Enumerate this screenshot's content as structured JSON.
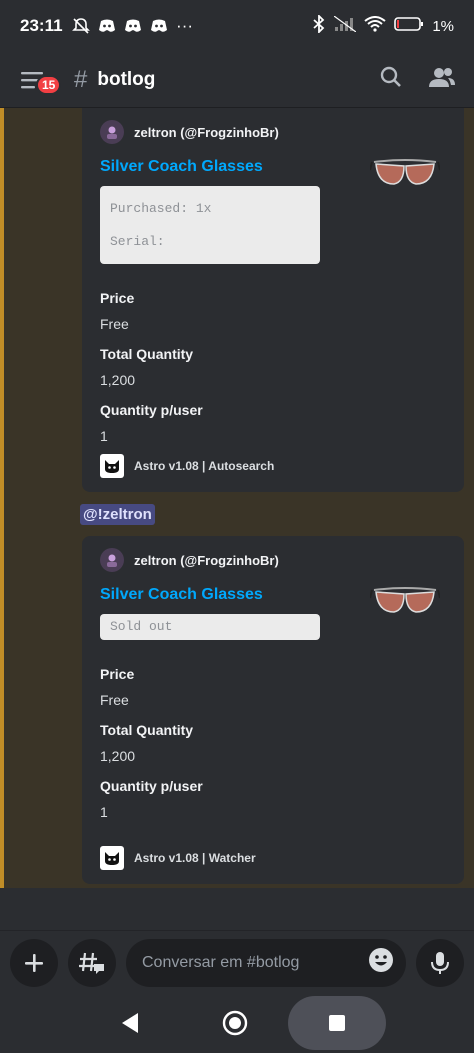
{
  "status_bar": {
    "time": "23:11",
    "icons": [
      "notifications-off-icon",
      "discord-icon",
      "discord-icon",
      "discord-icon",
      "more-icon"
    ],
    "more": "···",
    "battery": "1%",
    "right_icons": [
      "bluetooth-icon",
      "signal-icon",
      "wifi-icon",
      "battery-icon"
    ]
  },
  "header": {
    "badge_count": "15",
    "hash": "#",
    "channel_name": "botlog"
  },
  "messages": [
    {
      "author": "zeltron (@FrogzinhoBr)",
      "title": "Silver Coach Glasses",
      "code_lines": [
        "Purchased: 1x",
        "Serial:"
      ],
      "fields": [
        {
          "name": "Price",
          "value": "Free"
        },
        {
          "name": "Total Quantity",
          "value": "1,200"
        },
        {
          "name": "Quantity p/user",
          "value": "1"
        }
      ],
      "footer": "Astro v1.08 | Autosearch"
    },
    {
      "mention": "@!zeltron",
      "author": "zeltron (@FrogzinhoBr)",
      "title": "Silver Coach Glasses",
      "code_lines": [
        "Sold out"
      ],
      "fields": [
        {
          "name": "Price",
          "value": "Free"
        },
        {
          "name": "Total Quantity",
          "value": "1,200"
        },
        {
          "name": "Quantity p/user",
          "value": "1"
        }
      ],
      "footer": "Astro v1.08 | Watcher"
    }
  ],
  "composer": {
    "placeholder": "Conversar em #botlog"
  },
  "colors": {
    "accent_link": "#00a8fc",
    "mention_bg": "#5865f2",
    "highlight_bar": "#c08d27",
    "badge": "#f23f43"
  }
}
